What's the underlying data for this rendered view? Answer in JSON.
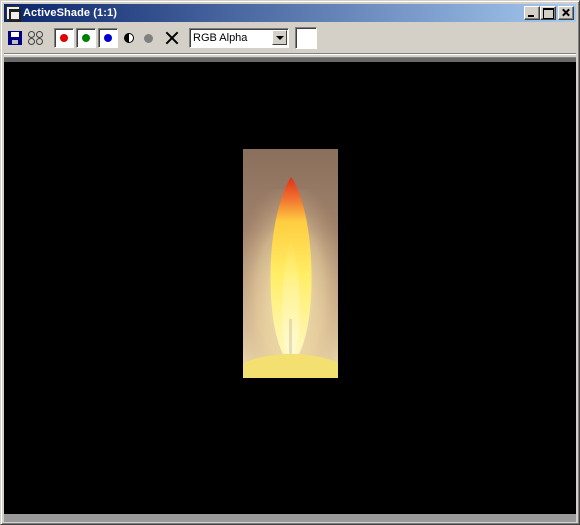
{
  "window": {
    "title": "ActiveShade (1:1)"
  },
  "toolbar": {
    "items": [
      {
        "icon": "save-icon"
      },
      {
        "icon": "clone-icon"
      },
      {
        "icon": "red-channel-icon",
        "color": "#e00000"
      },
      {
        "icon": "green-channel-icon",
        "color": "#008000"
      },
      {
        "icon": "blue-channel-icon",
        "color": "#0000d0"
      },
      {
        "icon": "monochrome-icon"
      },
      {
        "icon": "gray-dot-icon"
      },
      {
        "icon": "clear-icon"
      }
    ],
    "channel_select": {
      "value": "RGB Alpha"
    },
    "color_swatch": "#ffffff"
  },
  "colors": {
    "title_gradient_start": "#0a246a",
    "title_gradient_end": "#a6caf0",
    "canvas_background": "#000000",
    "flame_core": "#ffee66",
    "flame_tip": "#e03018"
  }
}
